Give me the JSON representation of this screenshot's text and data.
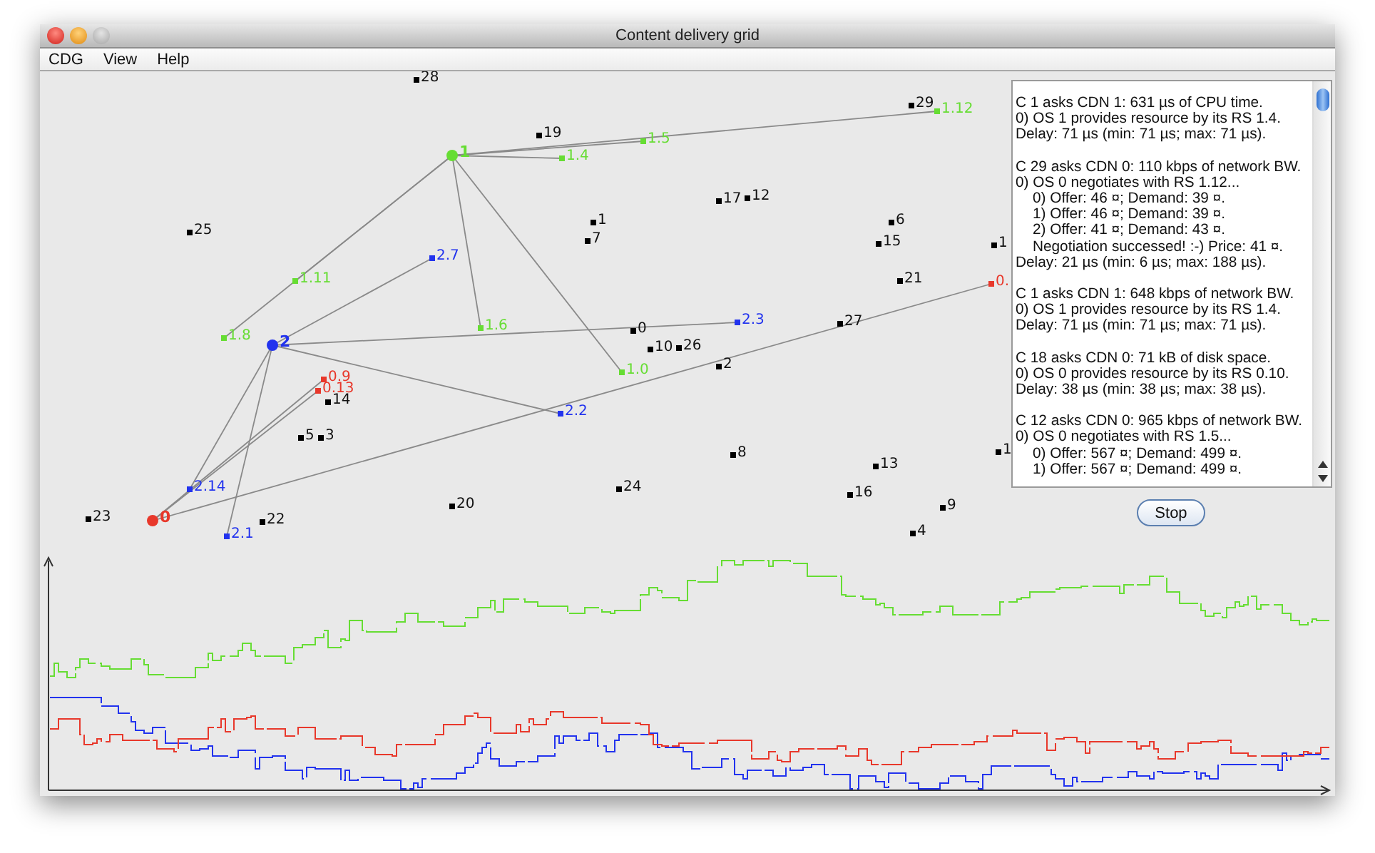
{
  "window": {
    "title": "Content delivery grid"
  },
  "menu": [
    "CDG",
    "View",
    "Help"
  ],
  "hubs": [
    {
      "label": "0",
      "color": "#e8382b",
      "children": [
        {
          "label": "0.9"
        },
        {
          "label": "0.13"
        },
        {
          "label": "0."
        }
      ]
    },
    {
      "label": "1",
      "color": "#66dd33",
      "children": [
        {
          "label": "1.4"
        },
        {
          "label": "1.5"
        },
        {
          "label": "1.12"
        },
        {
          "label": "1.11"
        },
        {
          "label": "1.8"
        },
        {
          "label": "1.6"
        },
        {
          "label": "1.0"
        }
      ]
    },
    {
      "label": "2",
      "color": "#2233ee",
      "children": [
        {
          "label": "2.7"
        },
        {
          "label": "2.3"
        },
        {
          "label": "2.2"
        },
        {
          "label": "2.14"
        },
        {
          "label": "2.1"
        }
      ]
    }
  ],
  "nodes": [
    "28",
    "19",
    "25",
    "1",
    "7",
    "17",
    "12",
    "6",
    "15",
    "1",
    "21",
    "0",
    "10",
    "26",
    "2",
    "27",
    "14",
    "5",
    "3",
    "8",
    "24",
    "20",
    "13",
    "16",
    "9",
    "4",
    "23",
    "22",
    "1",
    "29"
  ],
  "log": [
    {
      "lines": [
        {
          "text": "C 1 asks CDN 1: 631 µs of CPU time."
        },
        {
          "text": "0) OS 1 provides resource by its RS 1.4."
        },
        {
          "text": "Delay: 71 µs (min: 71 µs; max: 71 µs)."
        }
      ]
    },
    {
      "lines": [
        {
          "text": "C 29 asks CDN 0: 110 kbps of network BW."
        },
        {
          "text": "0) OS 0 negotiates with RS 1.12...",
          "children": [
            "0) Offer: 46 ¤; Demand: 39 ¤.",
            "1) Offer: 46 ¤; Demand: 39 ¤.",
            "2) Offer: 41 ¤; Demand: 43 ¤.",
            "Negotiation successed! :-) Price: 41 ¤."
          ]
        },
        {
          "text": "Delay: 21 µs (min: 6 µs; max: 188 µs)."
        }
      ]
    },
    {
      "lines": [
        {
          "text": "C 1 asks CDN 1: 648 kbps of network BW."
        },
        {
          "text": "0) OS 1 provides resource by its RS 1.4."
        },
        {
          "text": "Delay: 71 µs (min: 71 µs; max: 71 µs)."
        }
      ]
    },
    {
      "lines": [
        {
          "text": "C 18 asks CDN 0: 71 kB of disk space."
        },
        {
          "text": "0) OS 0 provides resource by its RS 0.10."
        },
        {
          "text": "Delay: 38 µs (min: 38 µs; max: 38 µs)."
        }
      ]
    },
    {
      "lines": [
        {
          "text": "C 12 asks CDN 0: 965 kbps of network BW."
        },
        {
          "text": "0) OS 0 negotiates with RS 1.5...",
          "children": [
            "0) Offer: 567 ¤; Demand: 499 ¤.",
            "1) Offer: 567 ¤; Demand: 499 ¤."
          ]
        }
      ]
    }
  ],
  "stop_button": "Stop"
}
